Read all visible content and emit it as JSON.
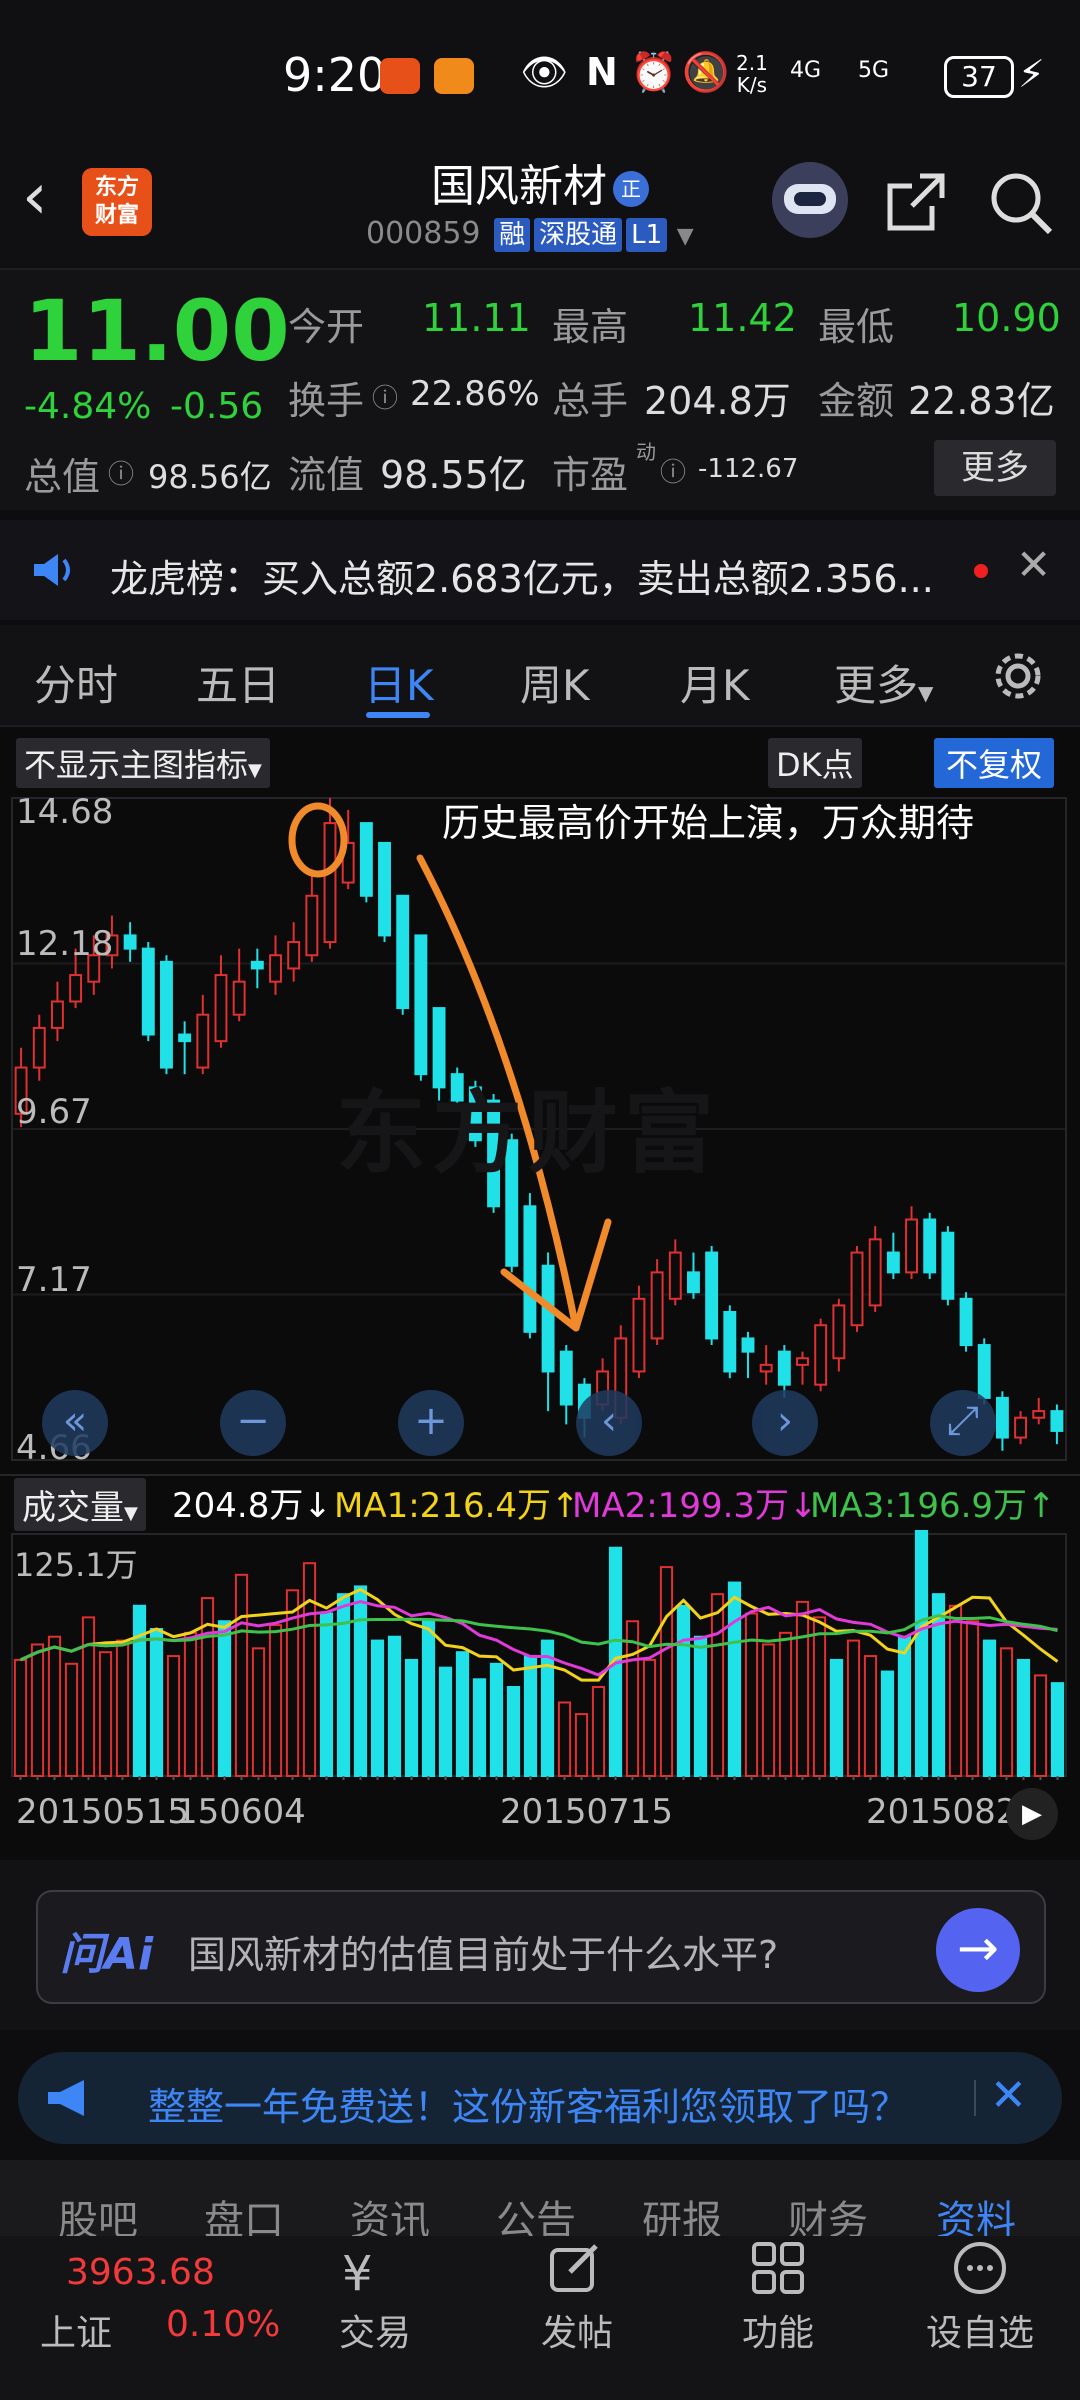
{
  "status_bar": {
    "time": "9:20",
    "net_speed_top": "2.1",
    "net_speed_bottom": "K/s",
    "sig1": "4G",
    "sig2": "5G",
    "battery": "37"
  },
  "header": {
    "logo_line1": "东方",
    "logo_line2": "财富",
    "stock_name": "国风新材",
    "zheng_badge": "正",
    "stock_code": "000859",
    "tag_rong": "融",
    "tag_sgt": "深股通",
    "tag_l1": "L1"
  },
  "quote": {
    "price": "11.00",
    "change_pct": "-4.84%",
    "change_abs": "-0.56",
    "open_label": "今开",
    "open": "11.11",
    "high_label": "最高",
    "high": "11.42",
    "low_label": "最低",
    "low": "10.90",
    "turnover_label": "换手",
    "turnover": "22.86%",
    "volume_label": "总手",
    "volume": "204.8万",
    "amount_label": "金额",
    "amount": "22.83亿",
    "mktcap_label": "总值",
    "mktcap": "98.56亿",
    "float_label": "流值",
    "float_cap": "98.55亿",
    "pe_label": "市盈",
    "pe_sup": "动",
    "pe": "-112.67",
    "more": "更多"
  },
  "notice": {
    "text": "龙虎榜：买入总额2.683亿元，卖出总额2.356..."
  },
  "tabs": [
    "分时",
    "五日",
    "日K",
    "周K",
    "月K",
    "更多"
  ],
  "chart_toolbar": {
    "indicator": "不显示主图指标",
    "dk": "DK点",
    "fq": "不复权"
  },
  "annotation": "历史最高价开始上演，万众期待",
  "watermark": "东方财富",
  "chart_data": [
    {
      "type": "candlestick",
      "ylim": [
        4.66,
        14.68
      ],
      "y_ticks": [
        "14.68",
        "12.18",
        "9.67",
        "7.17",
        "4.66"
      ],
      "open": [
        9.9,
        10.6,
        11.2,
        11.6,
        11.9,
        12.3,
        12.6,
        12.4,
        12.2,
        11.1,
        10.6,
        11.0,
        11.4,
        12.2,
        11.9,
        12.1,
        12.3,
        12.5,
        13.4,
        14.3,
        14.0,
        13.2,
        12.6,
        11.5,
        10.5,
        10.3,
        10.1,
        9.5,
        8.5,
        7.6,
        6.3,
        5.8,
        5.5,
        5.3,
        6.0,
        6.5,
        7.1,
        7.5,
        7.8,
        6.9,
        6.5,
        6.0,
        6.3,
        6.1,
        5.8,
        6.2,
        6.7,
        7.0,
        7.8,
        7.5,
        8.3,
        8.1,
        7.1,
        6.4,
        5.6,
        5.0,
        5.3,
        5.4
      ],
      "close": [
        10.6,
        11.2,
        11.6,
        12.0,
        12.3,
        12.6,
        12.4,
        11.1,
        10.6,
        11.0,
        11.4,
        12.0,
        11.9,
        12.1,
        12.3,
        12.5,
        13.2,
        14.3,
        14.0,
        13.2,
        12.6,
        11.5,
        10.5,
        10.3,
        10.1,
        9.5,
        8.5,
        7.6,
        6.6,
        6.0,
        5.5,
        5.3,
        6.0,
        6.5,
        7.1,
        7.5,
        7.8,
        7.2,
        6.5,
        6.0,
        6.3,
        6.1,
        5.8,
        6.2,
        6.7,
        7.0,
        7.8,
        8.0,
        7.5,
        8.3,
        7.5,
        7.1,
        6.4,
        5.6,
        5.0,
        5.3,
        5.4,
        5.1
      ],
      "high": [
        10.9,
        11.4,
        11.9,
        12.4,
        12.6,
        12.9,
        12.8,
        12.5,
        12.3,
        11.3,
        11.7,
        12.3,
        12.4,
        12.4,
        12.6,
        12.8,
        13.6,
        14.68,
        14.5,
        14.2,
        13.3,
        12.8,
        11.7,
        10.8,
        10.6,
        10.4,
        10.2,
        9.6,
        8.7,
        7.8,
        6.4,
        5.9,
        6.2,
        6.7,
        7.3,
        7.7,
        8.0,
        7.8,
        7.9,
        7.0,
        6.6,
        6.4,
        6.4,
        6.3,
        6.8,
        7.1,
        7.9,
        8.2,
        8.1,
        8.5,
        8.4,
        8.2,
        7.2,
        6.5,
        5.7,
        5.4,
        5.6,
        5.5
      ],
      "low": [
        9.7,
        10.4,
        11.0,
        11.5,
        11.7,
        12.1,
        12.2,
        11.0,
        10.5,
        10.5,
        10.5,
        10.9,
        11.3,
        11.8,
        11.7,
        11.9,
        12.2,
        12.4,
        13.3,
        13.1,
        12.5,
        11.4,
        10.4,
        10.1,
        10.0,
        9.4,
        8.4,
        7.5,
        6.5,
        5.4,
        5.2,
        5.0,
        5.4,
        5.2,
        5.9,
        6.4,
        7.0,
        7.1,
        6.4,
        5.9,
        5.9,
        5.8,
        5.6,
        5.8,
        5.7,
        6.0,
        6.6,
        6.9,
        7.4,
        7.4,
        7.4,
        7.0,
        6.3,
        5.5,
        4.8,
        4.9,
        5.2,
        4.9
      ]
    },
    {
      "type": "bar",
      "title": "成交量",
      "current_volume": "204.8万",
      "ma1": "MA1:216.4万",
      "ma2": "MA2:199.3万",
      "ma3": "MA3:196.9万",
      "ylim": [
        0,
        125.1
      ],
      "y_label": "125.1万",
      "x_labels": [
        "20150515",
        "150604",
        "20150715",
        "2015082"
      ],
      "values": [
        60,
        68,
        72,
        58,
        82,
        64,
        70,
        88,
        76,
        62,
        74,
        92,
        80,
        104,
        66,
        78,
        96,
        110,
        84,
        94,
        98,
        70,
        72,
        60,
        80,
        56,
        64,
        50,
        58,
        46,
        62,
        70,
        38,
        32,
        46,
        118,
        80,
        60,
        108,
        88,
        72,
        94,
        100,
        84,
        68,
        74,
        90,
        82,
        60,
        70,
        62,
        54,
        72,
        128,
        94,
        88,
        80,
        70,
        66,
        60,
        52,
        48
      ],
      "up": [
        1,
        1,
        1,
        1,
        1,
        1,
        1,
        0,
        0,
        1,
        1,
        1,
        0,
        1,
        1,
        1,
        1,
        1,
        0,
        0,
        0,
        0,
        0,
        0,
        0,
        0,
        0,
        0,
        0,
        0,
        0,
        0,
        1,
        1,
        1,
        0,
        1,
        1,
        1,
        0,
        0,
        1,
        0,
        1,
        1,
        1,
        1,
        1,
        0,
        1,
        1,
        0,
        0,
        0,
        0,
        1,
        1,
        0,
        1,
        0,
        1,
        0
      ]
    }
  ],
  "ai": {
    "logo": "问Ai",
    "prompt": "国风新材的估值目前处于什么水平?"
  },
  "promo": {
    "text": "整整一年免费送！这份新客福利您领取了吗？"
  },
  "bottom_tabs": [
    "股吧",
    "盘口",
    "资讯",
    "公告",
    "研报",
    "财务",
    "资料"
  ],
  "index": {
    "value": "3963.68",
    "name": "上证",
    "change": "0.10%"
  },
  "bottom_nav": [
    "交易",
    "发帖",
    "功能",
    "设自选"
  ]
}
